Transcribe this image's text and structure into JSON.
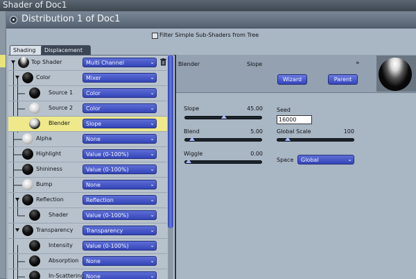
{
  "background_window": {
    "title": "Shader of Doc1"
  },
  "dialog": {
    "title": "Distribution 1 of Doc1",
    "filter_label": "Filter Simple Sub-Shaders from Tree",
    "filter_checked": false
  },
  "tabs": [
    {
      "label": "Shading",
      "active": true
    },
    {
      "label": "Displacement",
      "active": false
    }
  ],
  "tree": {
    "rows": [
      {
        "label": "Top Shader",
        "value": "Multi Channel",
        "sphere": "white-top"
      },
      {
        "label": "Color",
        "value": "Mixer",
        "sphere": "black"
      },
      {
        "label": "Source 1",
        "value": "Color",
        "sphere": "black"
      },
      {
        "label": "Source 2",
        "value": "Color",
        "sphere": "white"
      },
      {
        "label": "Blender",
        "value": "Slope",
        "sphere": "mix",
        "selected": true
      },
      {
        "label": "Alpha",
        "value": "None",
        "sphere": "white"
      },
      {
        "label": "Highlight",
        "value": "Value (0-100%)",
        "sphere": "black"
      },
      {
        "label": "Shininess",
        "value": "Value (0-100%)",
        "sphere": "black"
      },
      {
        "label": "Bump",
        "value": "None",
        "sphere": "white"
      },
      {
        "label": "Reflection",
        "value": "Reflection",
        "sphere": "black"
      },
      {
        "label": "Shader",
        "value": "Value (0-100%)",
        "sphere": "black"
      },
      {
        "label": "Transparency",
        "value": "Transparency",
        "sphere": "black"
      },
      {
        "label": "Intensity",
        "value": "Value (0-100%)",
        "sphere": "black"
      },
      {
        "label": "Absorption",
        "value": "None",
        "sphere": "black"
      },
      {
        "label": "In-Scattering",
        "value": "None",
        "sphere": "black"
      }
    ]
  },
  "editor": {
    "node_label": "Blender",
    "shader_type": "Slope",
    "wizard_label": "Wizard",
    "parent_label": "Parent",
    "params": {
      "slope_label": "Slope",
      "slope_value": "45.00",
      "slope_fraction": 0.5,
      "blend_label": "Blend",
      "blend_value": "5.00",
      "blend_fraction": 0.05,
      "wiggle_label": "Wiggle",
      "wiggle_value": "0.00",
      "wiggle_fraction": 0.0,
      "seed_label": "Seed",
      "seed_value": "16000",
      "global_scale_label": "Global Scale",
      "global_scale_value": "100",
      "global_scale_fraction": 0.1,
      "space_label": "Space",
      "space_value": "Global"
    }
  },
  "icons": {
    "trash": "trash-icon",
    "chevron": "chevron-down-icon",
    "dialog": "circle-icon"
  },
  "colors": {
    "dropdown": "#3d4ec4",
    "selected_row": "#efe98c",
    "panel": "#a9b6c4"
  }
}
